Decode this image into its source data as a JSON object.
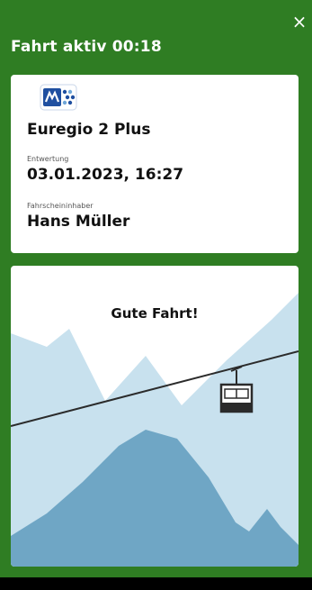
{
  "header": {
    "title": "Fahrt aktiv 00:18",
    "close_glyph": "×"
  },
  "ticket": {
    "logo_icon": "euregio-logo-icon",
    "product": "Euregio 2 Plus",
    "validation_label": "Entwertung",
    "validation_value": "03.01.2023, 16:27",
    "holder_label": "Fahrscheininhaber",
    "holder_value": "Hans Müller"
  },
  "scene": {
    "greeting": "Gute Fahrt!",
    "illustration_icon": "cable-car-icon"
  },
  "colors": {
    "background_green": "#2f7d23",
    "mountain_light": "#c8e1ee",
    "mountain_dark": "#6fa6c5",
    "cable": "#2b2b2b"
  }
}
